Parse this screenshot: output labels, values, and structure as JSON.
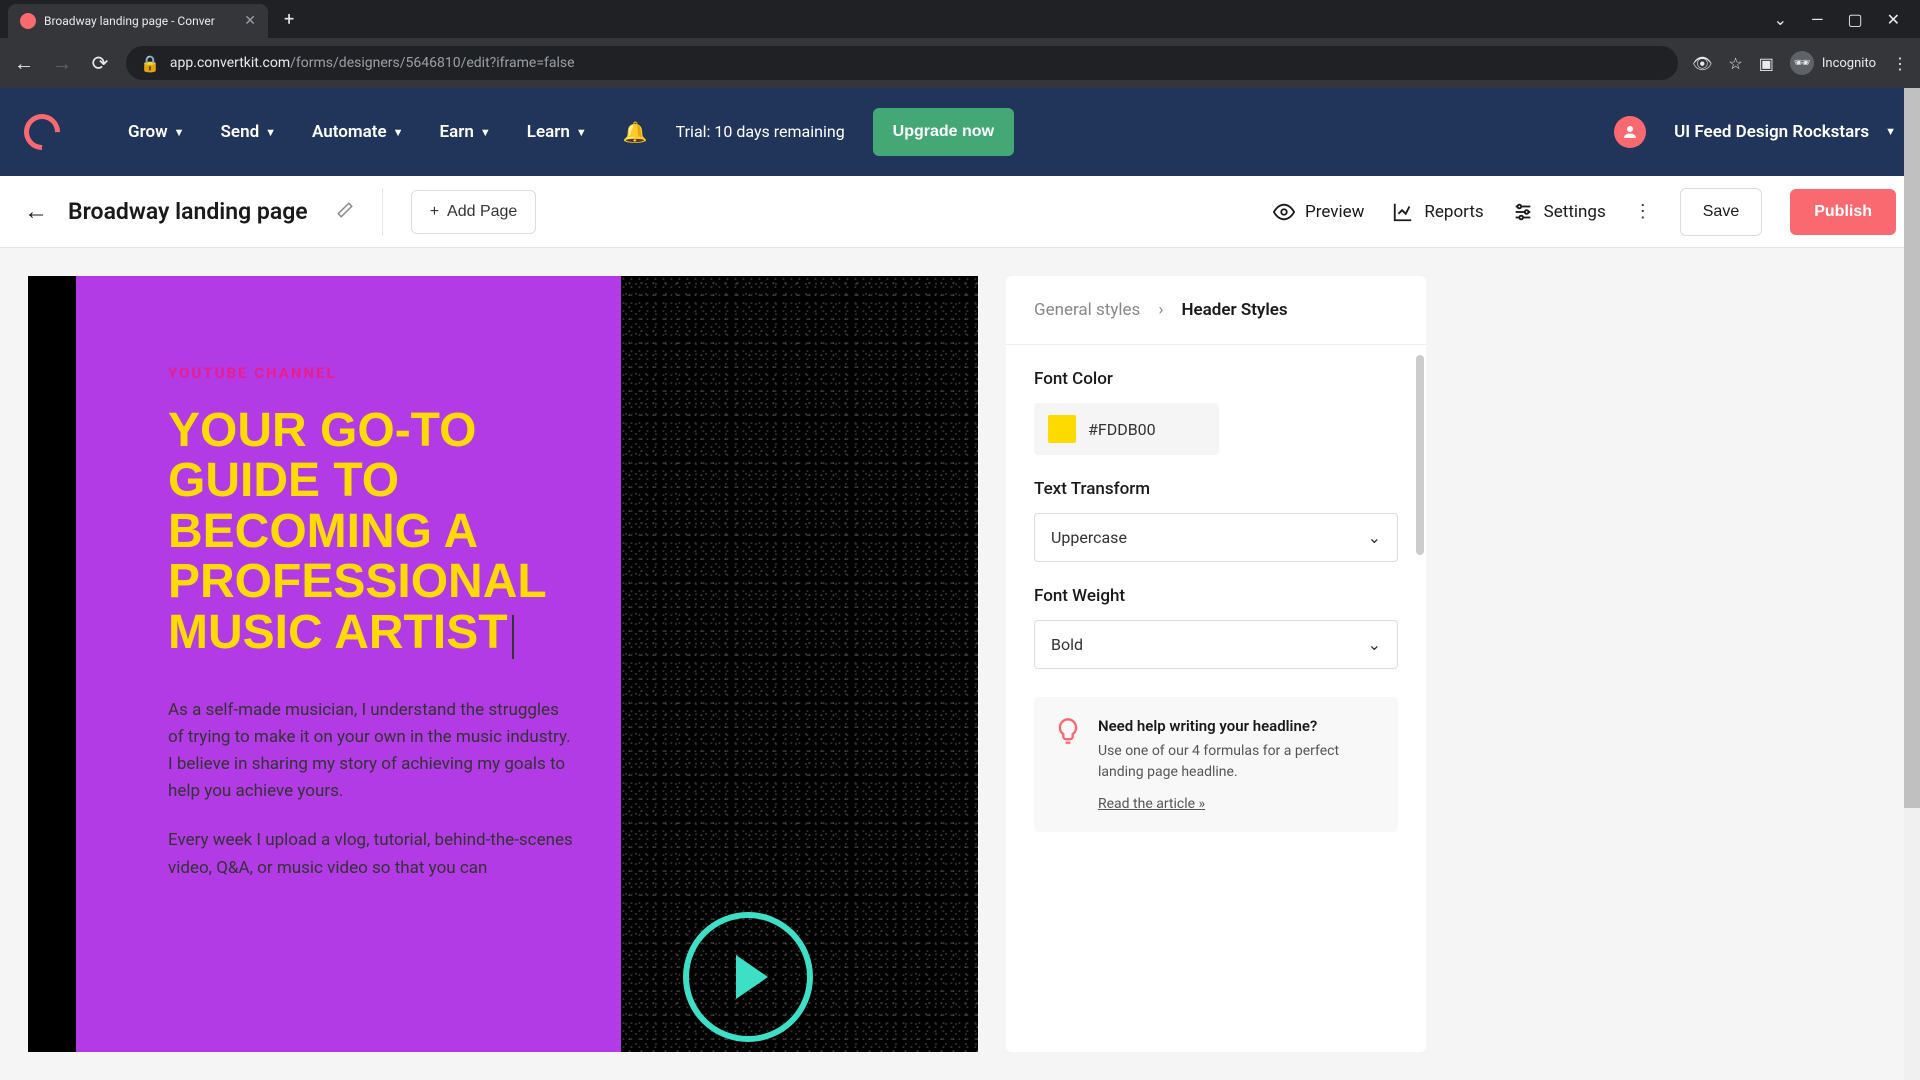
{
  "browser": {
    "tab_title": "Broadway landing page - Conver",
    "url_domain": "app.convertkit.com",
    "url_path": "/forms/designers/5646810/edit?iframe=false",
    "incognito_label": "Incognito"
  },
  "nav": {
    "items": [
      "Grow",
      "Send",
      "Automate",
      "Earn",
      "Learn"
    ],
    "trial_text": "Trial: 10 days remaining",
    "upgrade_label": "Upgrade now",
    "account_name": "UI Feed Design Rockstars"
  },
  "toolbar": {
    "page_title": "Broadway landing page",
    "add_page": "Add Page",
    "preview": "Preview",
    "reports": "Reports",
    "settings": "Settings",
    "save": "Save",
    "publish": "Publish"
  },
  "canvas": {
    "eyebrow": "YOUTUBE CHANNEL",
    "headline": "YOUR GO-TO GUIDE TO BECOMING A PROFESSIONAL MUSIC ARTIST",
    "para1": "As a self-made musician, I understand the struggles of trying to make it on your own in the music industry. I believe in sharing my story of achieving my goals to help you achieve yours.",
    "para2": "Every week I upload a vlog, tutorial, behind-the-scenes video, Q&A, or music video so that you can"
  },
  "sidebar": {
    "breadcrumb_parent": "General styles",
    "breadcrumb_current": "Header Styles",
    "font_color": {
      "label": "Font Color",
      "value": "#FDDB00"
    },
    "text_transform": {
      "label": "Text Transform",
      "value": "Uppercase"
    },
    "font_weight": {
      "label": "Font Weight",
      "value": "Bold"
    },
    "help": {
      "title": "Need help writing your headline?",
      "text": "Use one of our 4 formulas for a perfect landing page headline.",
      "link": "Read the article »"
    }
  }
}
